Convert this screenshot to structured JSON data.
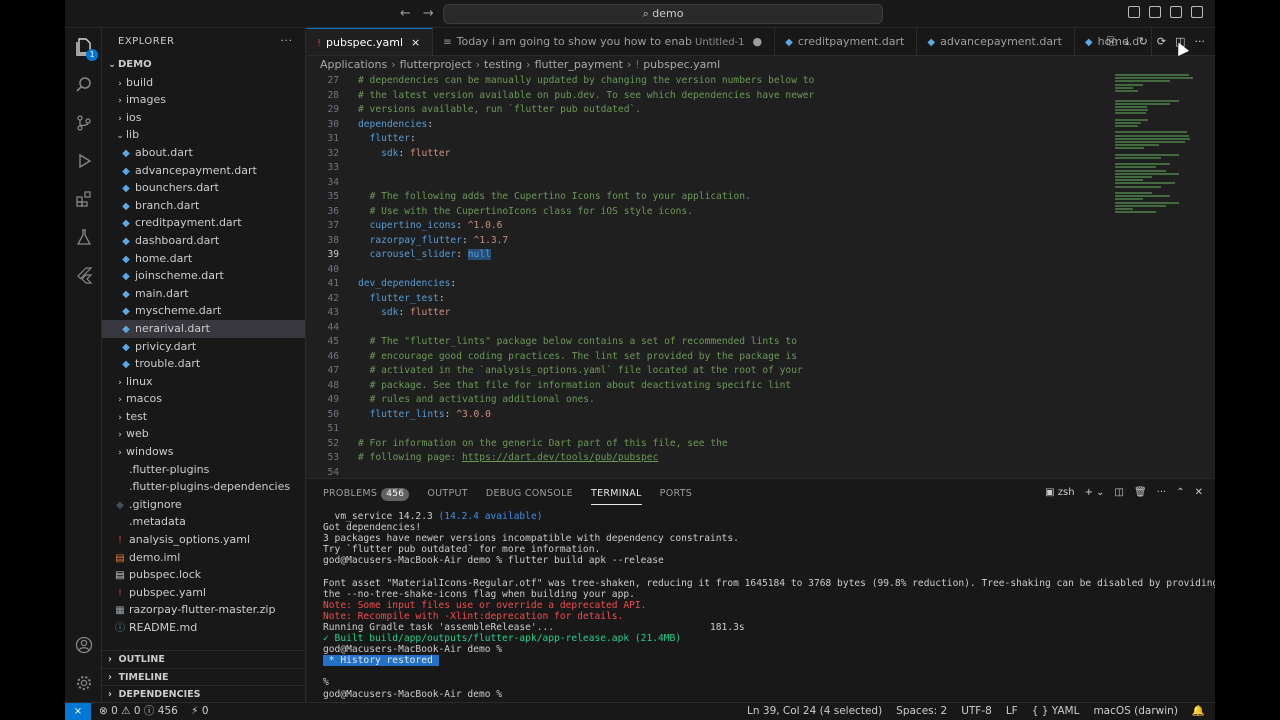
{
  "window": {
    "search_text": "demo"
  },
  "explorer": {
    "title": "EXPLORER",
    "more": "···",
    "root": "DEMO",
    "items": [
      {
        "label": "build",
        "type": "folder",
        "depth": 1,
        "open": false
      },
      {
        "label": "images",
        "type": "folder",
        "depth": 1,
        "open": false
      },
      {
        "label": "ios",
        "type": "folder",
        "depth": 1,
        "open": false
      },
      {
        "label": "lib",
        "type": "folder",
        "depth": 1,
        "open": true
      },
      {
        "label": "about.dart",
        "type": "dart",
        "depth": 2
      },
      {
        "label": "advancepayment.dart",
        "type": "dart",
        "depth": 2
      },
      {
        "label": "bounchers.dart",
        "type": "dart",
        "depth": 2
      },
      {
        "label": "branch.dart",
        "type": "dart",
        "depth": 2
      },
      {
        "label": "creditpayment.dart",
        "type": "dart",
        "depth": 2
      },
      {
        "label": "dashboard.dart",
        "type": "dart",
        "depth": 2
      },
      {
        "label": "home.dart",
        "type": "dart",
        "depth": 2
      },
      {
        "label": "joinscheme.dart",
        "type": "dart",
        "depth": 2
      },
      {
        "label": "main.dart",
        "type": "dart",
        "depth": 2
      },
      {
        "label": "myscheme.dart",
        "type": "dart",
        "depth": 2
      },
      {
        "label": "nerarival.dart",
        "type": "dart",
        "depth": 2,
        "selected": true
      },
      {
        "label": "privicy.dart",
        "type": "dart",
        "depth": 2
      },
      {
        "label": "trouble.dart",
        "type": "dart",
        "depth": 2
      },
      {
        "label": "linux",
        "type": "folder",
        "depth": 1,
        "open": false
      },
      {
        "label": "macos",
        "type": "folder",
        "depth": 1,
        "open": false
      },
      {
        "label": "test",
        "type": "folder",
        "depth": 1,
        "open": false
      },
      {
        "label": "web",
        "type": "folder",
        "depth": 1,
        "open": false
      },
      {
        "label": "windows",
        "type": "folder",
        "depth": 1,
        "open": false
      },
      {
        "label": ".flutter-plugins",
        "type": "plain",
        "depth": 1
      },
      {
        "label": ".flutter-plugins-dependencies",
        "type": "plain",
        "depth": 1
      },
      {
        "label": ".gitignore",
        "type": "git",
        "depth": 1
      },
      {
        "label": ".metadata",
        "type": "plain",
        "depth": 1
      },
      {
        "label": "analysis_options.yaml",
        "type": "yaml",
        "depth": 1
      },
      {
        "label": "demo.iml",
        "type": "iml",
        "depth": 1
      },
      {
        "label": "pubspec.lock",
        "type": "lock",
        "depth": 1
      },
      {
        "label": "pubspec.yaml",
        "type": "yaml",
        "depth": 1
      },
      {
        "label": "razorpay-flutter-master.zip",
        "type": "zip",
        "depth": 1
      },
      {
        "label": "README.md",
        "type": "info",
        "depth": 1
      }
    ],
    "sections": [
      "OUTLINE",
      "TIMELINE",
      "DEPENDENCIES"
    ]
  },
  "tabs": [
    {
      "label": "pubspec.yaml",
      "icon": "!",
      "active": true,
      "close": "×"
    },
    {
      "label": "Today i am going to show you how to enab",
      "suffix": "Untitled-1",
      "icon": "≡",
      "dirty": "●"
    },
    {
      "label": "creditpayment.dart",
      "icon": "◆"
    },
    {
      "label": "advancepayment.dart",
      "icon": "◆"
    },
    {
      "label": "home.d",
      "icon": "◆"
    }
  ],
  "breadcrumb": [
    "Applications",
    "flutterproject",
    "testing",
    "flutter_payment",
    "pubspec.yaml"
  ],
  "editor": {
    "lines": [
      {
        "n": "27",
        "parts": [
          {
            "c": "c-com",
            "t": "# dependencies can be manually updated by changing the version numbers below to"
          }
        ]
      },
      {
        "n": "28",
        "parts": [
          {
            "c": "c-com",
            "t": "# the latest version available on pub.dev. To see which dependencies have newer"
          }
        ]
      },
      {
        "n": "29",
        "parts": [
          {
            "c": "c-com",
            "t": "# versions available, run `flutter pub outdated`."
          }
        ]
      },
      {
        "n": "30",
        "parts": [
          {
            "c": "c-key",
            "t": "dependencies"
          },
          {
            "c": "",
            "t": ":"
          }
        ]
      },
      {
        "n": "31",
        "parts": [
          {
            "c": "",
            "t": "  "
          },
          {
            "c": "c-key",
            "t": "flutter"
          },
          {
            "c": "",
            "t": ":"
          }
        ]
      },
      {
        "n": "32",
        "parts": [
          {
            "c": "",
            "t": "    "
          },
          {
            "c": "c-key",
            "t": "sdk"
          },
          {
            "c": "",
            "t": ": "
          },
          {
            "c": "c-str",
            "t": "flutter"
          }
        ]
      },
      {
        "n": "33",
        "parts": []
      },
      {
        "n": "34",
        "parts": []
      },
      {
        "n": "35",
        "parts": [
          {
            "c": "",
            "t": "  "
          },
          {
            "c": "c-com",
            "t": "# The following adds the Cupertino Icons font to your application."
          }
        ]
      },
      {
        "n": "36",
        "parts": [
          {
            "c": "",
            "t": "  "
          },
          {
            "c": "c-com",
            "t": "# Use with the CupertinoIcons class for iOS style icons."
          }
        ]
      },
      {
        "n": "37",
        "parts": [
          {
            "c": "",
            "t": "  "
          },
          {
            "c": "c-key",
            "t": "cupertino_icons"
          },
          {
            "c": "",
            "t": ": "
          },
          {
            "c": "c-str",
            "t": "^1.0.6"
          }
        ]
      },
      {
        "n": "38",
        "parts": [
          {
            "c": "",
            "t": "  "
          },
          {
            "c": "c-key",
            "t": "razorpay_flutter"
          },
          {
            "c": "",
            "t": ": "
          },
          {
            "c": "c-str",
            "t": "^1.3.7"
          }
        ]
      },
      {
        "n": "39",
        "cur": true,
        "parts": [
          {
            "c": "",
            "t": "  "
          },
          {
            "c": "c-key",
            "t": "carousel_slider"
          },
          {
            "c": "",
            "t": ": "
          },
          {
            "c": "c-null",
            "t": "null"
          }
        ]
      },
      {
        "n": "40",
        "parts": []
      },
      {
        "n": "41",
        "parts": [
          {
            "c": "c-key",
            "t": "dev_dependencies"
          },
          {
            "c": "",
            "t": ":"
          }
        ]
      },
      {
        "n": "42",
        "parts": [
          {
            "c": "",
            "t": "  "
          },
          {
            "c": "c-key",
            "t": "flutter_test"
          },
          {
            "c": "",
            "t": ":"
          }
        ]
      },
      {
        "n": "43",
        "parts": [
          {
            "c": "",
            "t": "    "
          },
          {
            "c": "c-key",
            "t": "sdk"
          },
          {
            "c": "",
            "t": ": "
          },
          {
            "c": "c-str",
            "t": "flutter"
          }
        ]
      },
      {
        "n": "44",
        "parts": []
      },
      {
        "n": "45",
        "parts": [
          {
            "c": "",
            "t": "  "
          },
          {
            "c": "c-com",
            "t": "# The \"flutter_lints\" package below contains a set of recommended lints to"
          }
        ]
      },
      {
        "n": "46",
        "parts": [
          {
            "c": "",
            "t": "  "
          },
          {
            "c": "c-com",
            "t": "# encourage good coding practices. The lint set provided by the package is"
          }
        ]
      },
      {
        "n": "47",
        "parts": [
          {
            "c": "",
            "t": "  "
          },
          {
            "c": "c-com",
            "t": "# activated in the `analysis_options.yaml` file located at the root of your"
          }
        ]
      },
      {
        "n": "48",
        "parts": [
          {
            "c": "",
            "t": "  "
          },
          {
            "c": "c-com",
            "t": "# package. See that file for information about deactivating specific lint"
          }
        ]
      },
      {
        "n": "49",
        "parts": [
          {
            "c": "",
            "t": "  "
          },
          {
            "c": "c-com",
            "t": "# rules and activating additional ones."
          }
        ]
      },
      {
        "n": "50",
        "parts": [
          {
            "c": "",
            "t": "  "
          },
          {
            "c": "c-key",
            "t": "flutter_lints"
          },
          {
            "c": "",
            "t": ": "
          },
          {
            "c": "c-str",
            "t": "^3.0.0"
          }
        ]
      },
      {
        "n": "51",
        "parts": []
      },
      {
        "n": "52",
        "parts": [
          {
            "c": "c-com",
            "t": "# For information on the generic Dart part of this file, see the"
          }
        ]
      },
      {
        "n": "53",
        "parts": [
          {
            "c": "c-com",
            "t": "# following page: "
          },
          {
            "c": "c-url",
            "t": "https://dart.dev/tools/pub/pubspec"
          }
        ]
      },
      {
        "n": "54",
        "parts": []
      }
    ]
  },
  "panel": {
    "tabs": [
      {
        "label": "PROBLEMS",
        "badge": "456"
      },
      {
        "label": "OUTPUT"
      },
      {
        "label": "DEBUG CONSOLE"
      },
      {
        "label": "TERMINAL",
        "active": true
      },
      {
        "label": "PORTS"
      }
    ],
    "shell": "zsh",
    "terminal": [
      {
        "parts": [
          {
            "c": "",
            "t": "  vm_service 14.2.3 "
          },
          {
            "c": "t-dim",
            "t": "(14.2.4 available)"
          }
        ]
      },
      {
        "parts": [
          {
            "c": "",
            "t": "Got dependencies!"
          }
        ]
      },
      {
        "parts": [
          {
            "c": "",
            "t": "3 packages have newer versions incompatible with dependency constraints."
          }
        ]
      },
      {
        "parts": [
          {
            "c": "",
            "t": "Try `flutter pub outdated` for more information."
          }
        ]
      },
      {
        "parts": [
          {
            "c": "",
            "t": "god@Macusers-MacBook-Air demo % flutter build apk --release"
          }
        ]
      },
      {
        "parts": []
      },
      {
        "parts": [
          {
            "c": "",
            "t": "Font asset \"MaterialIcons-Regular.otf\" was tree-shaken, reducing it from 1645184 to 3768 bytes (99.8% reduction). Tree-shaking can be disabled by providing"
          }
        ]
      },
      {
        "parts": [
          {
            "c": "",
            "t": "the --no-tree-shake-icons flag when building your app."
          }
        ]
      },
      {
        "parts": [
          {
            "c": "t-red",
            "t": "Note: Some input files use or override a deprecated API."
          }
        ]
      },
      {
        "parts": [
          {
            "c": "t-red",
            "t": "Note: Recompile with -Xlint:deprecation for details."
          }
        ]
      },
      {
        "parts": [
          {
            "c": "",
            "t": "Running Gradle task 'assembleRelease'...                           181.3s"
          }
        ]
      },
      {
        "parts": [
          {
            "c": "t-green",
            "t": "✓ Built build/app/outputs/flutter-apk/app-release.apk (21.4MB)"
          }
        ]
      },
      {
        "parts": [
          {
            "c": "",
            "t": "god@Macusers-MacBook-Air demo %"
          }
        ]
      },
      {
        "parts": [
          {
            "c": "t-hl",
            "t": " * History restored "
          }
        ]
      },
      {
        "parts": []
      },
      {
        "parts": [
          {
            "c": "",
            "t": "%"
          }
        ]
      },
      {
        "parts": [
          {
            "c": "",
            "t": "god@Macusers-MacBook-Air demo %"
          }
        ]
      }
    ]
  },
  "status": {
    "errors": "⊗ 0 ⚠ 0 ⓘ 456",
    "ports": "⚡ 0",
    "position": "Ln 39, Col 24 (4 selected)",
    "spaces": "Spaces: 2",
    "encoding": "UTF-8",
    "eol": "LF",
    "language": "{ } YAML",
    "platform": "macOS (darwin)"
  },
  "colors": {
    "accent": "#0078d4",
    "background": "#1f1f1f",
    "sidebar": "#181818"
  }
}
